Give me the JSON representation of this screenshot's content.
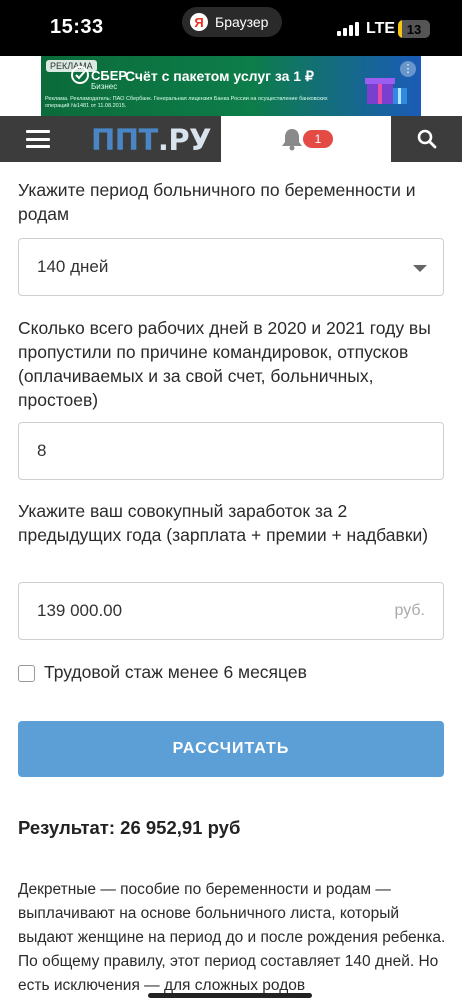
{
  "status_bar": {
    "time": "15:33",
    "browser_label": "Браузер",
    "browser_icon": "yandex-browser-icon",
    "network": "LTE",
    "battery": "13",
    "battery_level": 0.13,
    "battery_color": "#f2c811"
  },
  "ad": {
    "tag": "РЕКЛАМА",
    "brand": "СБЕР",
    "brand_sub": "Бизнес",
    "title": "Счёт с пакетом услуг за 1 ₽",
    "legal": "Реклама. Рекламодатель: ПАО Сбербанк. Генеральная лицензия Банка России на осуществление банковских операций №1481 от 11.08.2015.",
    "menu_icon": "more-vertical-icon"
  },
  "header": {
    "logo_main": "ППТ",
    "logo_suffix": ".РУ",
    "notifications_count": "1",
    "menu_icon": "hamburger-icon",
    "bell_icon": "bell-icon",
    "search_icon": "search-icon",
    "accent_color": "#4a86c5"
  },
  "form": {
    "period_label": "Укажите период больничного по беременности и родам",
    "period_value": "140 дней",
    "missed_label": "Сколько всего рабочих дней в 2020 и 2021 году вы пропустили по причине командировок, отпусков (оплачиваемых и за свой счет, больничных, простоев)",
    "missed_value": "8",
    "earnings_label": "Укажите ваш совокупный заработок за 2 предыдущих года (зарплата + премии + надбавки)",
    "earnings_value": "139 000.00",
    "earnings_unit": "руб.",
    "experience_checkbox_label": "Трудовой стаж менее 6 месяцев",
    "experience_checked": false,
    "calculate_label": "РАССЧИТАТЬ",
    "button_color": "#5c9fd6"
  },
  "result": {
    "text": "Результат: 26 952,91 руб"
  },
  "description": {
    "text": "Декретные — пособие по беременности и родам — выплачивают на основе больничного листа, который выдают женщине на период до и после рождения ребенка. По общему правилу, этот период составляет 140 дней. Но есть исключения — для сложных родов"
  }
}
